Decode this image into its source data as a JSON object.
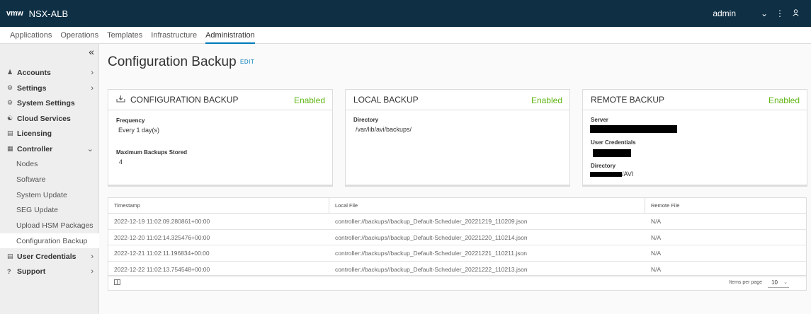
{
  "header": {
    "logo": "vmw",
    "app_name": "NSX-ALB",
    "user": "admin",
    "icons": [
      "chevron-down-icon",
      "more-vertical-icon",
      "user-icon"
    ],
    "colors": {
      "bg": "#0e2f44",
      "accent": "#0079b8",
      "success": "#60b515"
    }
  },
  "nav": {
    "tabs": [
      "Applications",
      "Operations",
      "Templates",
      "Infrastructure",
      "Administration"
    ],
    "active": "Administration"
  },
  "sidebar": {
    "collapse": "«",
    "items": [
      {
        "label": "Accounts",
        "icon": "accounts-icon",
        "caret": "›"
      },
      {
        "label": "Settings",
        "icon": "settings-icon",
        "caret": "›"
      },
      {
        "label": "System Settings",
        "icon": "gear-icon"
      },
      {
        "label": "Cloud Services",
        "icon": "cloud-services-icon"
      },
      {
        "label": "Licensing",
        "icon": "licensing-icon"
      },
      {
        "label": "Controller",
        "icon": "controller-icon",
        "caret": "⌄"
      },
      {
        "label": "Nodes"
      },
      {
        "label": "Software"
      },
      {
        "label": "System Update"
      },
      {
        "label": "SEG Update"
      },
      {
        "label": "Upload HSM Packages"
      },
      {
        "label": "Configuration Backup",
        "selected": true
      },
      {
        "label": "User Credentials",
        "icon": "credentials-icon",
        "caret": "›"
      },
      {
        "label": "Support",
        "icon": "help-icon",
        "caret": "›"
      }
    ]
  },
  "page": {
    "title": "Configuration Backup",
    "edit": "EDIT"
  },
  "cards": {
    "config": {
      "title": "CONFIGURATION BACKUP",
      "status": "Enabled",
      "frequency_label": "Frequency",
      "frequency": "Every 1 day(s)",
      "max_label": "Maximum Backups Stored",
      "max": "4"
    },
    "local": {
      "title": "LOCAL BACKUP",
      "status": "Enabled",
      "directory_label": "Directory",
      "directory": "/var/lib/avi/backups/"
    },
    "remote": {
      "title": "REMOTE BACKUP",
      "status": "Enabled",
      "server_label": "Server",
      "credentials_label": "User Credentials",
      "directory_label": "Directory",
      "directory_suffix": "/AVI"
    }
  },
  "table": {
    "columns": [
      "Timestamp",
      "Local File",
      "Remote File"
    ],
    "rows": [
      [
        "2022-12-19 11:02:09.280861+00:00",
        "controller://backups//backup_Default-Scheduler_20221219_110209.json",
        "N/A"
      ],
      [
        "2022-12-20 11:02:14.325476+00:00",
        "controller://backups//backup_Default-Scheduler_20221220_110214.json",
        "N/A"
      ],
      [
        "2022-12-21 11:02:11.196834+00:00",
        "controller://backups//backup_Default-Scheduler_20221221_110211.json",
        "N/A"
      ],
      [
        "2022-12-22 11:02:13.754548+00:00",
        "controller://backups//backup_Default-Scheduler_20221222_110213.json",
        "N/A"
      ]
    ],
    "items_per_page_label": "Items per page",
    "items_per_page": "10"
  }
}
